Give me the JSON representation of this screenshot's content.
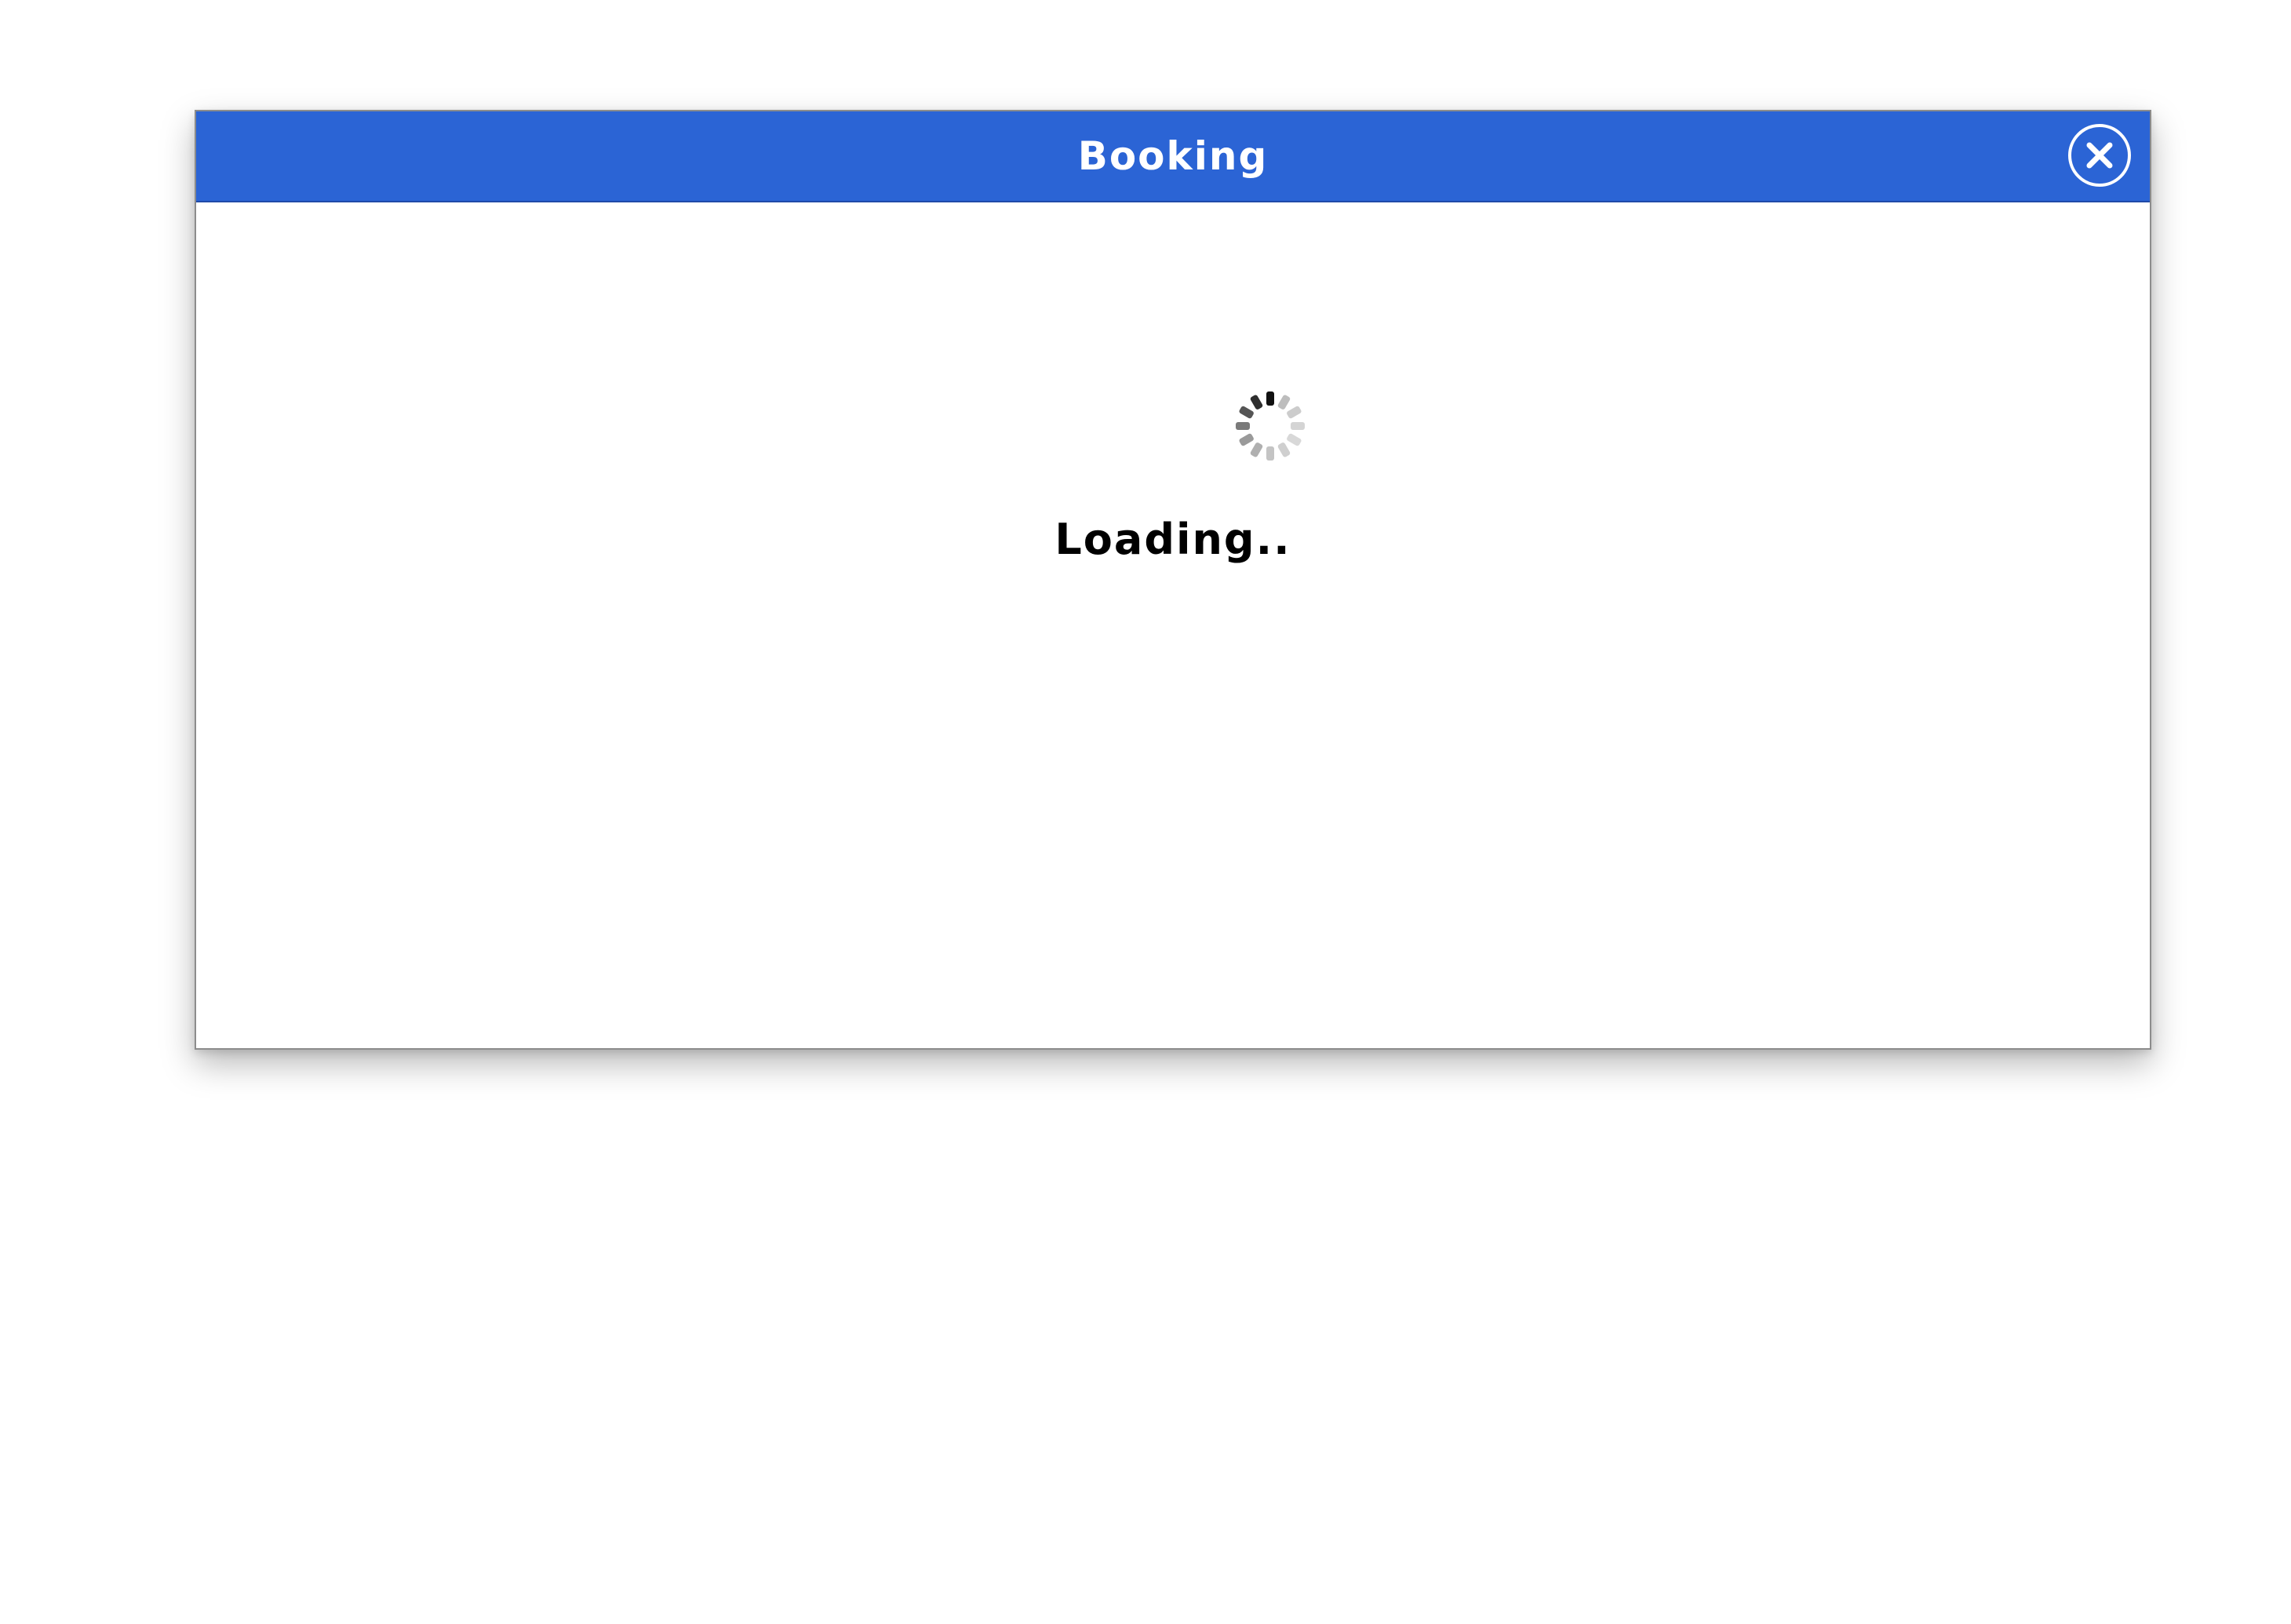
{
  "dialog": {
    "title": "Booking",
    "close_icon": "close-icon",
    "loading_text": "Loading..",
    "spinner_icon": "spinner-icon"
  },
  "colors": {
    "titlebar": "#2b64d5",
    "title_text": "#ffffff",
    "body_text": "#000000"
  }
}
